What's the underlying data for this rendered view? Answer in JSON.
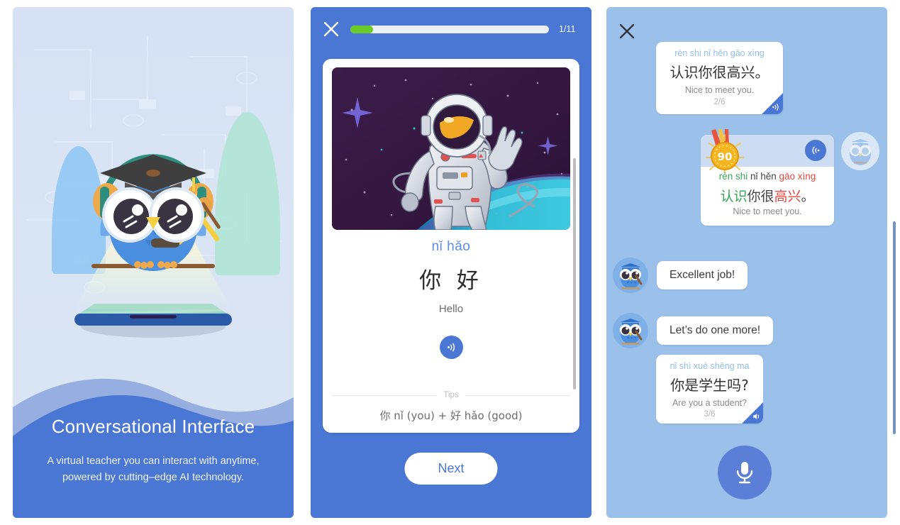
{
  "colors": {
    "brand_blue": "#4a76d4",
    "panel1_bg": "#d7e3f4",
    "panel2_bg": "#4a76d4",
    "panel3_bg": "#9bc1ea",
    "progress_green": "#69cc2a",
    "tone_good_green": "#35a853",
    "tone_bad_red": "#e8453c",
    "pinyin_blue": "#5b8def",
    "bubble_pinyin_blue": "#93bdf0",
    "medal_gold": "#f5b51f",
    "wave_front": "#4a76d4",
    "wave_back": "#96aee0"
  },
  "onboarding": {
    "title": "Conversational Interface",
    "subtitle_line1": "A virtual teacher you can interact with anytime,",
    "subtitle_line2": "powered by cutting–edge AI technology.",
    "illustration": "owl-teacher-hologram"
  },
  "lesson": {
    "close_icon": "close-icon",
    "progress_percent": 11.5,
    "progress_label": "1/11",
    "current_card": 1,
    "total_cards": 11,
    "image_alt": "astronaut-waving-in-space",
    "pinyin": "nǐ hǎo",
    "hanzi": "你 好",
    "english": "Hello",
    "speaker_icon": "speaker-icon",
    "tips_label": "Tips",
    "tips_text": "你 nǐ (you) + 好 hǎo (good)",
    "next_label": "Next"
  },
  "chat": {
    "close_icon": "close-icon",
    "messages": [
      {
        "kind": "prompt",
        "pinyin": "rèn shi nǐ hěn gāo xìng",
        "hanzi": "认识你很高兴。",
        "english": "Nice to meet you.",
        "counter": "2/6",
        "audio_icon": "speaker-icon"
      },
      {
        "kind": "scored",
        "score": "90",
        "audio_icon": "sound-wave-icon",
        "pinyin_parts": [
          {
            "text": "rèn shi ",
            "tone": "good"
          },
          {
            "text": "nǐ hěn ",
            "tone": "ok"
          },
          {
            "text": "gāo xìng",
            "tone": "bad"
          }
        ],
        "hanzi_parts": [
          {
            "text": "认识",
            "tone": "good"
          },
          {
            "text": "你很",
            "tone": "ok"
          },
          {
            "text": "高兴",
            "tone": "bad"
          },
          {
            "text": "。",
            "tone": "ok"
          }
        ],
        "english": "Nice to meet you."
      },
      {
        "kind": "teacher",
        "text": "Excellent job!",
        "avatar": "owl-avatar"
      },
      {
        "kind": "teacher",
        "text": "Let’s do one more!",
        "avatar": "owl-avatar"
      },
      {
        "kind": "prompt",
        "pinyin": "nǐ shì xué shēng ma",
        "hanzi": "你是学生吗?",
        "english": "Are you a student?",
        "counter": "3/6",
        "audio_icon": "speaker-icon"
      }
    ],
    "mic_icon": "microphone-icon"
  }
}
